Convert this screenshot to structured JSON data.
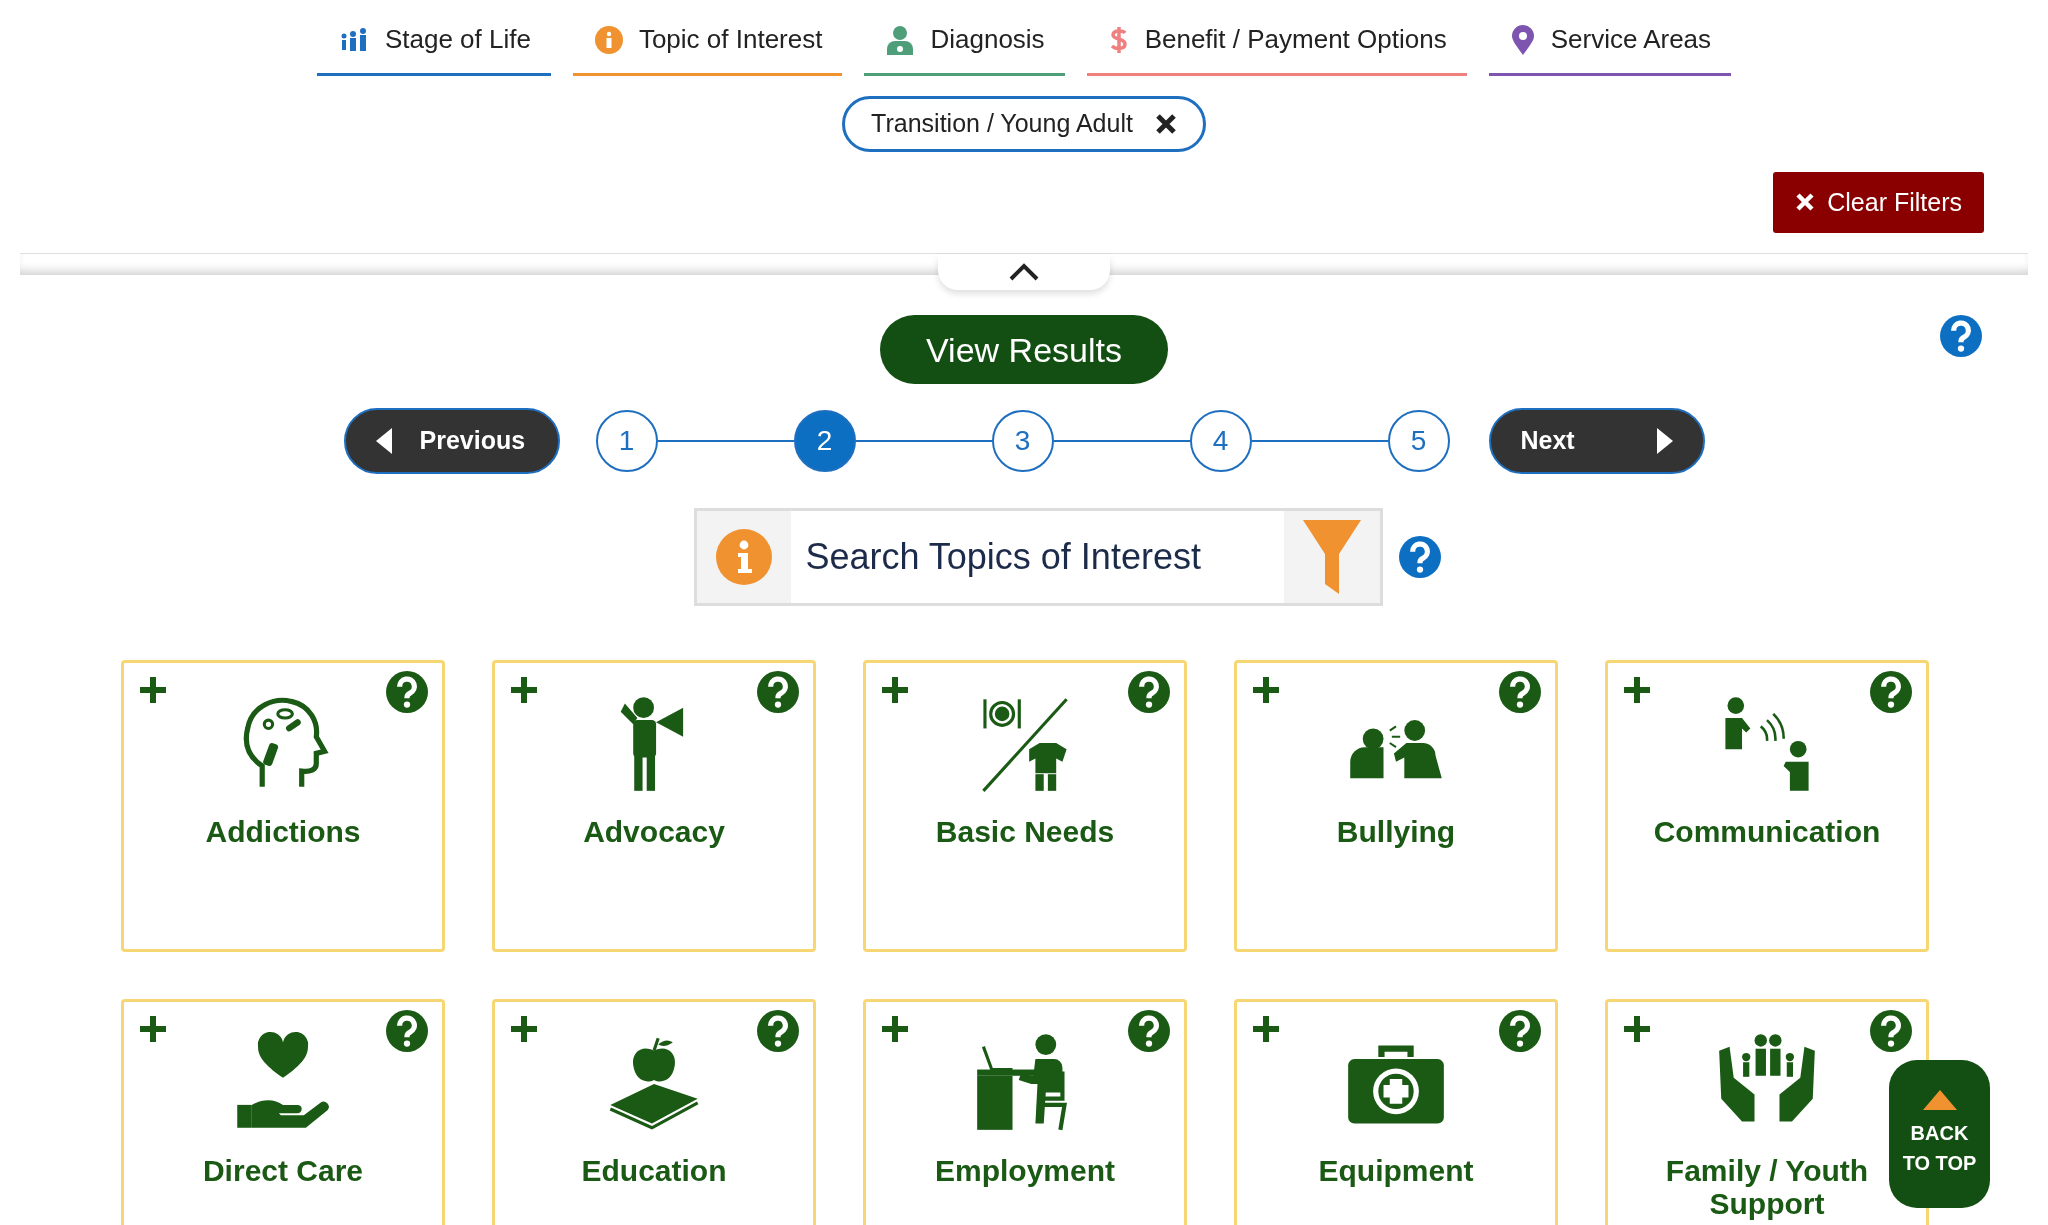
{
  "filter_tabs": [
    {
      "label": "Stage of Life",
      "color": "#1f6fc0"
    },
    {
      "label": "Topic of Interest",
      "color": "#f0922f"
    },
    {
      "label": "Diagnosis",
      "color": "#4f9e7a"
    },
    {
      "label": "Benefit / Payment Options",
      "color": "#f08080"
    },
    {
      "label": "Service Areas",
      "color": "#7d55b0"
    }
  ],
  "active_filters": [
    {
      "label": "Transition / Young Adult"
    }
  ],
  "clear_filters_button": "Clear Filters",
  "view_results_button": "View Results",
  "pagination": {
    "previous": "Previous",
    "next": "Next",
    "steps": [
      {
        "label": "1",
        "selected": false
      },
      {
        "label": "2",
        "selected": true
      },
      {
        "label": "3",
        "selected": false
      },
      {
        "label": "4",
        "selected": false
      },
      {
        "label": "5",
        "selected": false
      }
    ]
  },
  "search": {
    "placeholder": "Search Topics of Interest"
  },
  "topics": [
    {
      "title": "Addictions"
    },
    {
      "title": "Advocacy"
    },
    {
      "title": "Basic Needs"
    },
    {
      "title": "Bullying"
    },
    {
      "title": "Communication"
    },
    {
      "title": "Direct Care"
    },
    {
      "title": "Education"
    },
    {
      "title": "Employment"
    },
    {
      "title": "Equipment"
    },
    {
      "title": "Family / Youth Support"
    }
  ],
  "back_to_top": "BACK TO TOP"
}
